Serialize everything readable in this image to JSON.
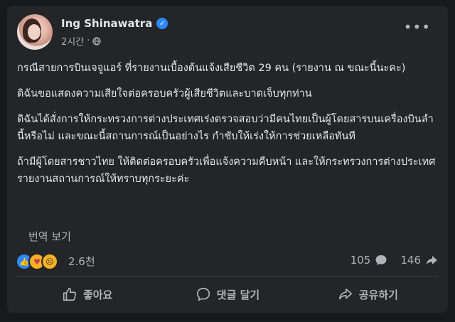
{
  "post": {
    "author": "Ing Shinawatra",
    "time": "2시간",
    "paragraphs": [
      "กรณีสายการบินเจจูแอร์ ที่รายงานเบื้องต้นแจ้งเสียชีวิต 29 คน (รายงาน ณ ขณะนี้นะคะ)",
      "ดิฉันขอแสดงความเสียใจต่อครอบครัวผู้เสียชีวิตและบาดเจ็บทุกท่าน",
      "ดิฉันได้สั่งการให้กระทรวงการต่างประเทศเร่งตรวจสอบว่ามีคนไทยเป็นผู้โดยสารบนเครื่องบินลำนี้หรือไม่ และขณะนี้สถานการณ์เป็นอย่างไร กำชับให้เร่งให้การช่วยเหลือทันที",
      "ถ้ามีผู้โดยสารชาวไทย ให้ติดต่อครอบครัวเพื่อแจ้งความคืบหน้า และให้กระทรวงการต่างประเทศรายงานสถานการณ์ให้ทราบทุกระยะค่ะ"
    ],
    "translate_label": "번역 보기",
    "reaction_count": "2.6천",
    "comment_count": "105",
    "share_count": "146"
  },
  "actions": {
    "like": "좋아요",
    "comment": "댓글 달기",
    "share": "공유하기"
  },
  "icons": {
    "verified": "verified-badge-icon",
    "globe": "globe-icon",
    "more": "more-options-icon"
  },
  "colors": {
    "background": "#18191a",
    "card": "#242526",
    "text": "#e4e6eb",
    "secondary": "#b0b3b8",
    "accent": "#2d88ff"
  }
}
